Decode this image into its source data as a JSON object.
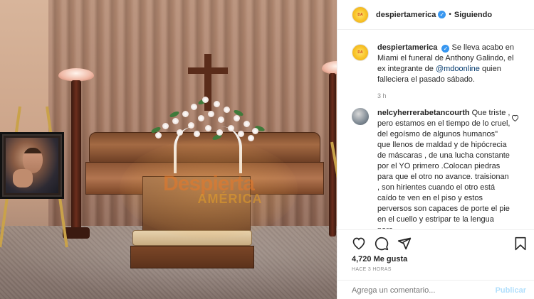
{
  "post": {
    "image_watermark": {
      "line1": "Despierta",
      "line2": "AMÉRICA"
    }
  },
  "header": {
    "username": "despiertamerica",
    "verified_glyph": "✓",
    "separator": "•",
    "follow_label": "Siguiendo",
    "avatar_label": "DA"
  },
  "caption": {
    "username": "despiertamerica",
    "text_before": "Se lleva acabo en Miami el funeral de Anthony Galindo, el ex integrante de ",
    "mention": "@mdoonline",
    "text_after": " quien falleciera el pasado sábado.",
    "time": "3 h"
  },
  "comment": {
    "username": "nelcyherrerabetancourth",
    "text": "Que triste , pero estamos en el tiempo de lo cruel, del egoísmo de algunos humanos\" que llenos de maldad y de hipócrecia de máscaras , de una lucha constante por el YO primero .Colocan piedras para que el otro no avance. traisionan , son hirientes cuando el otro está caído te ven en el piso y estos perversos son capaces de porte el pie en el cuello y estripar te la lengua para"
  },
  "actions": {
    "icons": [
      "heart-icon",
      "comment-icon",
      "share-icon",
      "bookmark-icon"
    ]
  },
  "likes": {
    "text": "4,720 Me gusta"
  },
  "timestamp": {
    "text": "HACE 3 HORAS"
  },
  "add_comment": {
    "placeholder": "Agrega un comentario...",
    "post_label": "Publicar"
  },
  "colors": {
    "verified": "#3897f0",
    "mention": "#00376b",
    "post_button_disabled": "#b2dffc",
    "muted": "#8e8e8e"
  }
}
